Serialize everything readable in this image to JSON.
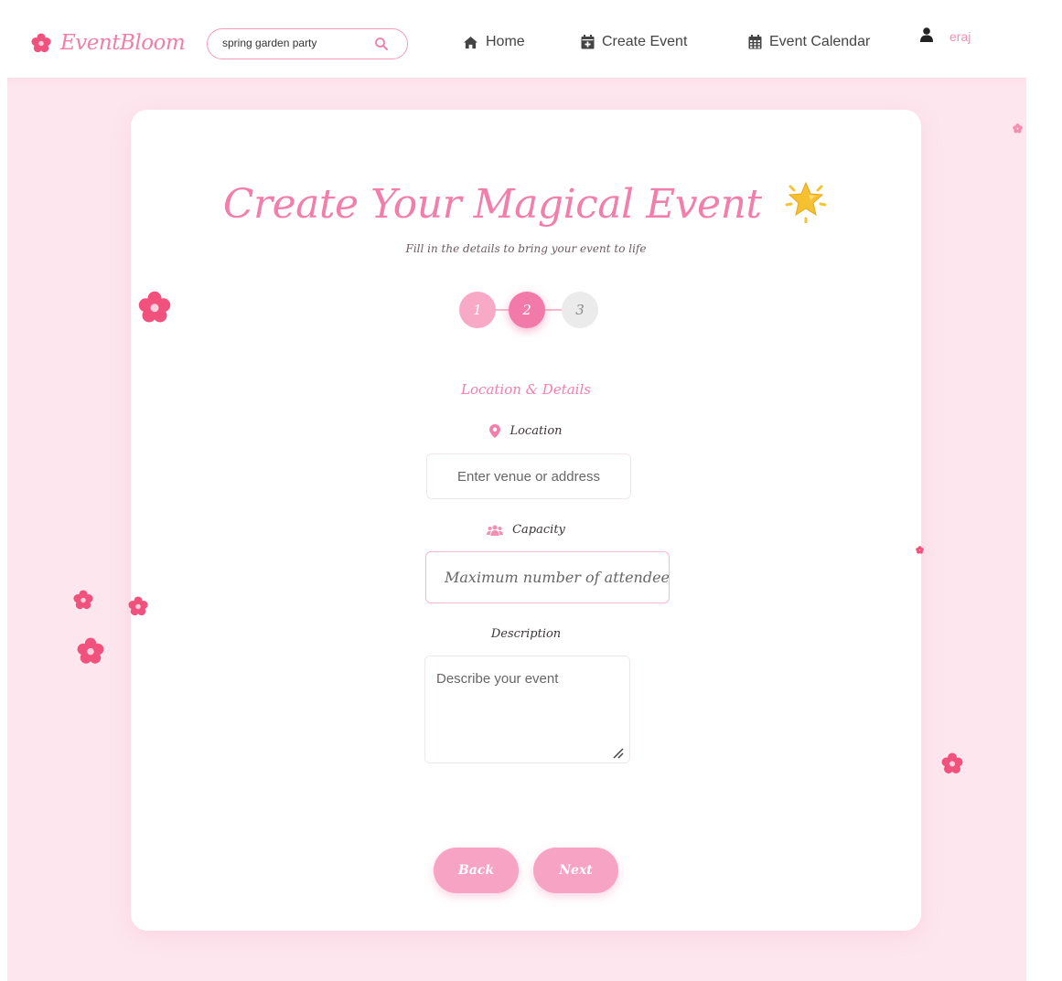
{
  "navbar": {
    "brand": "EventBloom",
    "search": {
      "value": "spring garden party"
    },
    "links": [
      {
        "label": "Home",
        "icon": "home-icon"
      },
      {
        "label": "Create Event",
        "icon": "calendar-plus-icon"
      },
      {
        "label": "Event Calendar",
        "icon": "calendar-icon"
      }
    ],
    "user": {
      "name": "eraj",
      "icon": "user-icon"
    }
  },
  "form": {
    "title": "Create Your Magical Event",
    "title_icon": "star-icon",
    "subtitle": "Fill in the details to bring your event to life",
    "steps": [
      {
        "label": "1",
        "status": "completed"
      },
      {
        "label": "2",
        "status": "active"
      },
      {
        "label": "3",
        "status": "pending"
      }
    ],
    "section_title": "Location & Details",
    "fields": {
      "location": {
        "label": "Location",
        "icon": "map-pin-icon",
        "placeholder": "Enter venue or address"
      },
      "capacity": {
        "label": "Capacity",
        "icon": "users-icon",
        "placeholder": "Maximum number of attendees"
      },
      "description": {
        "label": "Description",
        "placeholder": "Describe your event"
      }
    },
    "buttons": {
      "back": "Back",
      "next": "Next"
    }
  },
  "colors": {
    "accent": "#f27fab",
    "button": "#f7a3c4",
    "background": "#fde6ee",
    "flower": "#f0527d"
  }
}
